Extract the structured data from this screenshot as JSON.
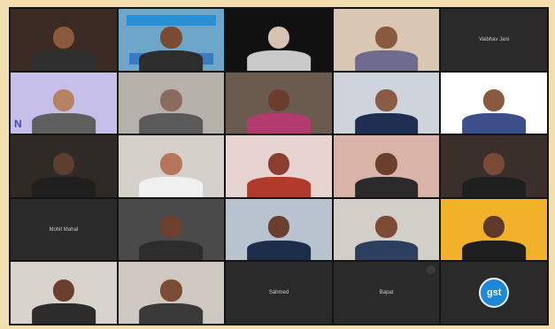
{
  "meeting": {
    "participants": [
      {
        "id": "p1",
        "name": "",
        "kind": "video",
        "bg": "#3c2b24",
        "skin": "#8b5a3c",
        "shirt": "#2f2f2f"
      },
      {
        "id": "p2",
        "name": "",
        "kind": "video-event",
        "bg": "#6da6c9",
        "skin": "#7a4a33",
        "shirt": "#2d2d2d"
      },
      {
        "id": "p3",
        "name": "",
        "kind": "video",
        "bg": "#111111",
        "skin": "#d7c1b3",
        "shirt": "#c9c9c9"
      },
      {
        "id": "p4",
        "name": "",
        "kind": "video",
        "bg": "#d9c7b4",
        "skin": "#8a5a40",
        "shirt": "#6f6b8e"
      },
      {
        "id": "p5",
        "name": "Vaibhav Jani",
        "kind": "name-only",
        "bg": "#2a2a2a"
      },
      {
        "id": "p6",
        "name": "",
        "kind": "video-n",
        "bg": "#c6bfe9",
        "skin": "#b48263",
        "shirt": "#5f5f5f",
        "badge": "N"
      },
      {
        "id": "p7",
        "name": "",
        "kind": "video",
        "bg": "#b7b1ab",
        "skin": "#8a6b5e",
        "shirt": "#5a5a5a"
      },
      {
        "id": "p8",
        "name": "",
        "kind": "video",
        "bg": "#6b5b4f",
        "skin": "#6b3d2f",
        "shirt": "#b43b70"
      },
      {
        "id": "p9",
        "name": "",
        "kind": "video",
        "bg": "#cfd3dc",
        "skin": "#8a5b45",
        "shirt": "#1e2f52"
      },
      {
        "id": "p10",
        "name": "",
        "kind": "video",
        "bg": "#ffffff",
        "skin": "#8a5a40",
        "shirt": "#3c4f8a"
      },
      {
        "id": "p11",
        "name": "",
        "kind": "video",
        "bg": "#2f2a25",
        "skin": "#5e3e2f",
        "shirt": "#1f1f1f"
      },
      {
        "id": "p12",
        "name": "",
        "kind": "video",
        "bg": "#d6d0cb",
        "skin": "#b5765c",
        "shirt": "#f0f0f0"
      },
      {
        "id": "p13",
        "name": "",
        "kind": "video",
        "bg": "#e7d3cf",
        "skin": "#8a3f31",
        "shirt": "#b23a2a"
      },
      {
        "id": "p14",
        "name": "",
        "kind": "video",
        "bg": "#d9b2a8",
        "skin": "#6b3f2c",
        "shirt": "#2a2a2a"
      },
      {
        "id": "p15",
        "name": "",
        "kind": "video",
        "bg": "#3a2f2a",
        "skin": "#7a4a36",
        "shirt": "#1f1f1f"
      },
      {
        "id": "p16",
        "name": "Mohit Mahal",
        "kind": "name-only",
        "bg": "#2a2a2a"
      },
      {
        "id": "p17",
        "name": "",
        "kind": "video",
        "bg": "#4a4a4a",
        "skin": "#6f3f2e",
        "shirt": "#2d2d2d"
      },
      {
        "id": "p18",
        "name": "",
        "kind": "video",
        "bg": "#b9c3cf",
        "skin": "#6a3f2f",
        "shirt": "#1e2e4a"
      },
      {
        "id": "p19",
        "name": "",
        "kind": "video",
        "bg": "#d2cfc9",
        "skin": "#7b4b36",
        "shirt": "#2c3f5e"
      },
      {
        "id": "p20",
        "name": "",
        "kind": "video",
        "bg": "#f1b12a",
        "skin": "#5f3a2b",
        "shirt": "#1f1f1f"
      },
      {
        "id": "p21",
        "name": "",
        "kind": "video",
        "bg": "#d9d3ce",
        "skin": "#6b3f2e",
        "shirt": "#2c2c2c"
      },
      {
        "id": "p22",
        "name": "",
        "kind": "video",
        "bg": "#cfc8c1",
        "skin": "#7b4b36",
        "shirt": "#3a3a3a"
      },
      {
        "id": "p23",
        "name": "Sahmed",
        "kind": "name-only",
        "bg": "#2a2a2a"
      },
      {
        "id": "p24",
        "name": "Bapat",
        "kind": "name-only-more",
        "bg": "#2a2a2a"
      },
      {
        "id": "p25",
        "name": "",
        "kind": "logo",
        "bg": "#2a2a2a",
        "logo_text": "gst"
      }
    ]
  }
}
